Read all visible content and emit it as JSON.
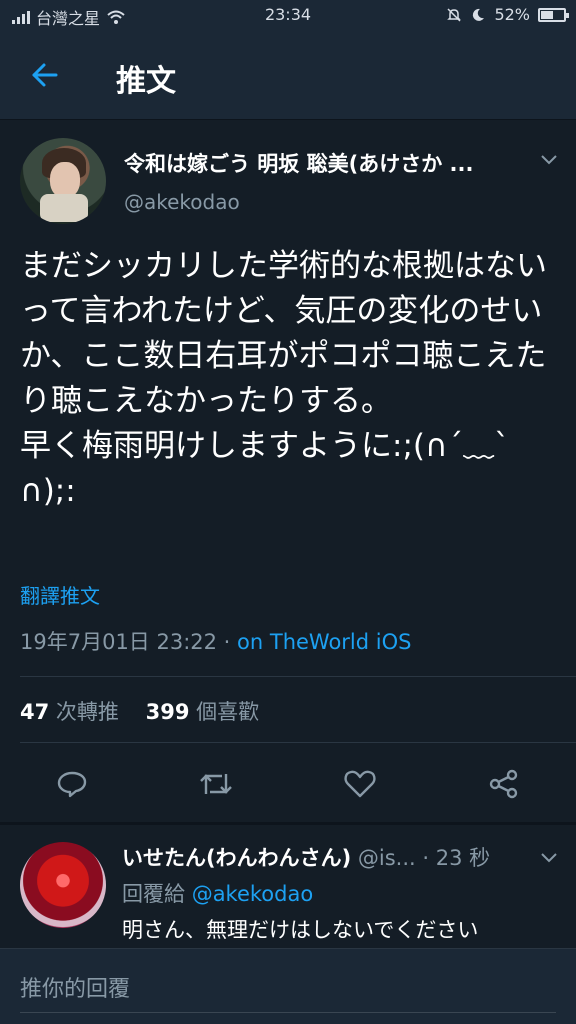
{
  "status_bar": {
    "carrier": "台灣之星",
    "time": "23:34",
    "battery": "52%",
    "battery_level": 0.52
  },
  "header": {
    "title": "推文"
  },
  "tweet": {
    "display_name": "令和は嫁ごう 明坂 聡美(あけさか ...",
    "handle": "@akekodao",
    "text": "まだシッカリした学術的な根拠はないって言われたけど、気圧の変化のせいか、ここ数日右耳がポコポコ聴こえたり聴こえなかったりする。\n早く梅雨明けしますように:;(∩´﹏`∩);:",
    "translate": "翻譯推文",
    "timestamp": "19年7月01日 23:22",
    "separator": " · ",
    "via": "on TheWorld iOS",
    "retweets_count": "47",
    "retweets_label": "次轉推",
    "likes_count": "399",
    "likes_label": "個喜歡"
  },
  "reply": {
    "display_name": "いせたん(わんわんさん)",
    "handle": "@is...",
    "time": "· 23 秒",
    "reply_to_label": "回覆給",
    "reply_to_handle": "@akekodao",
    "text": "明さん、無理だけはしないでください"
  },
  "compose": {
    "placeholder": "推你的回覆"
  },
  "colors": {
    "background": "#141d26",
    "bar": "#1b2836",
    "accent": "#1da1f2",
    "secondary_text": "#8899a6"
  },
  "icons": {
    "back": "arrow-left-icon",
    "reply": "comment-icon",
    "retweet": "retweet-icon",
    "like": "heart-icon",
    "share": "share-icon",
    "more": "chevron-down-icon",
    "wifi": "wifi-icon",
    "mute": "bell-off-icon",
    "moon": "moon-icon"
  }
}
